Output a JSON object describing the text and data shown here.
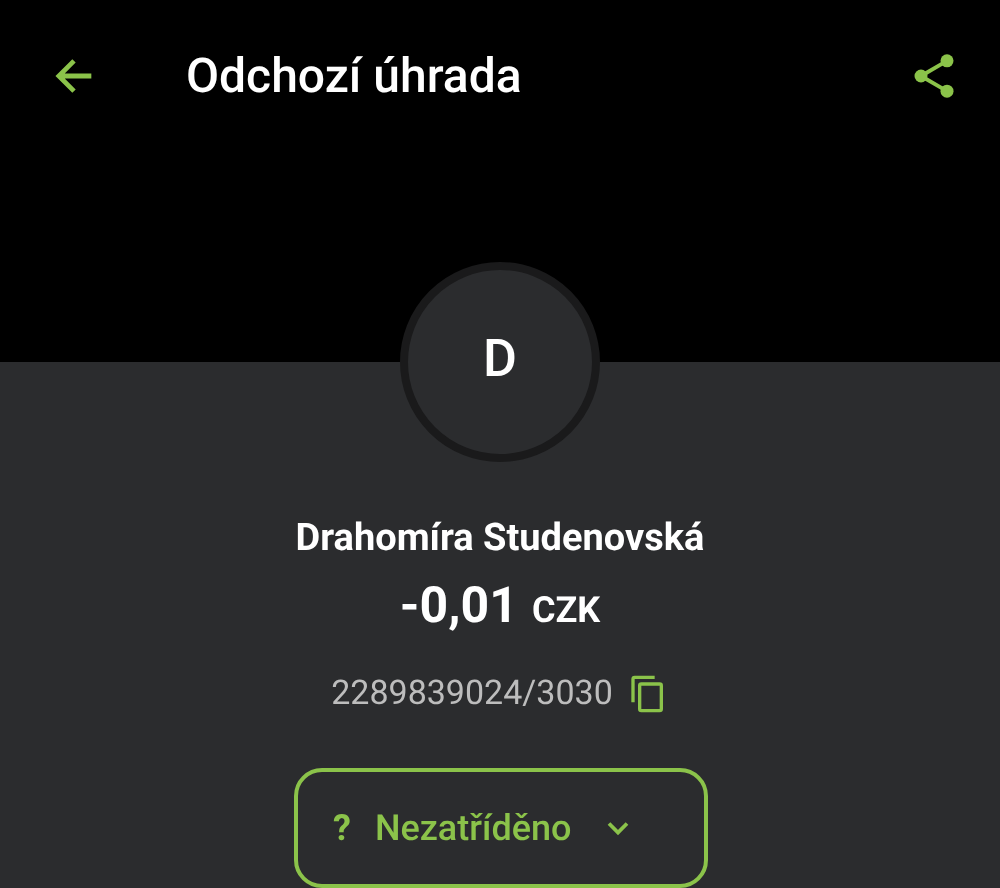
{
  "header": {
    "title": "Odchozí úhrada"
  },
  "counterparty": {
    "initial": "D",
    "name": "Drahomíra Studenovská",
    "amount": "-0,01",
    "currency": "CZK",
    "account": "2289839024/3030"
  },
  "category": {
    "mark": "?",
    "label": "Nezatříděno"
  }
}
